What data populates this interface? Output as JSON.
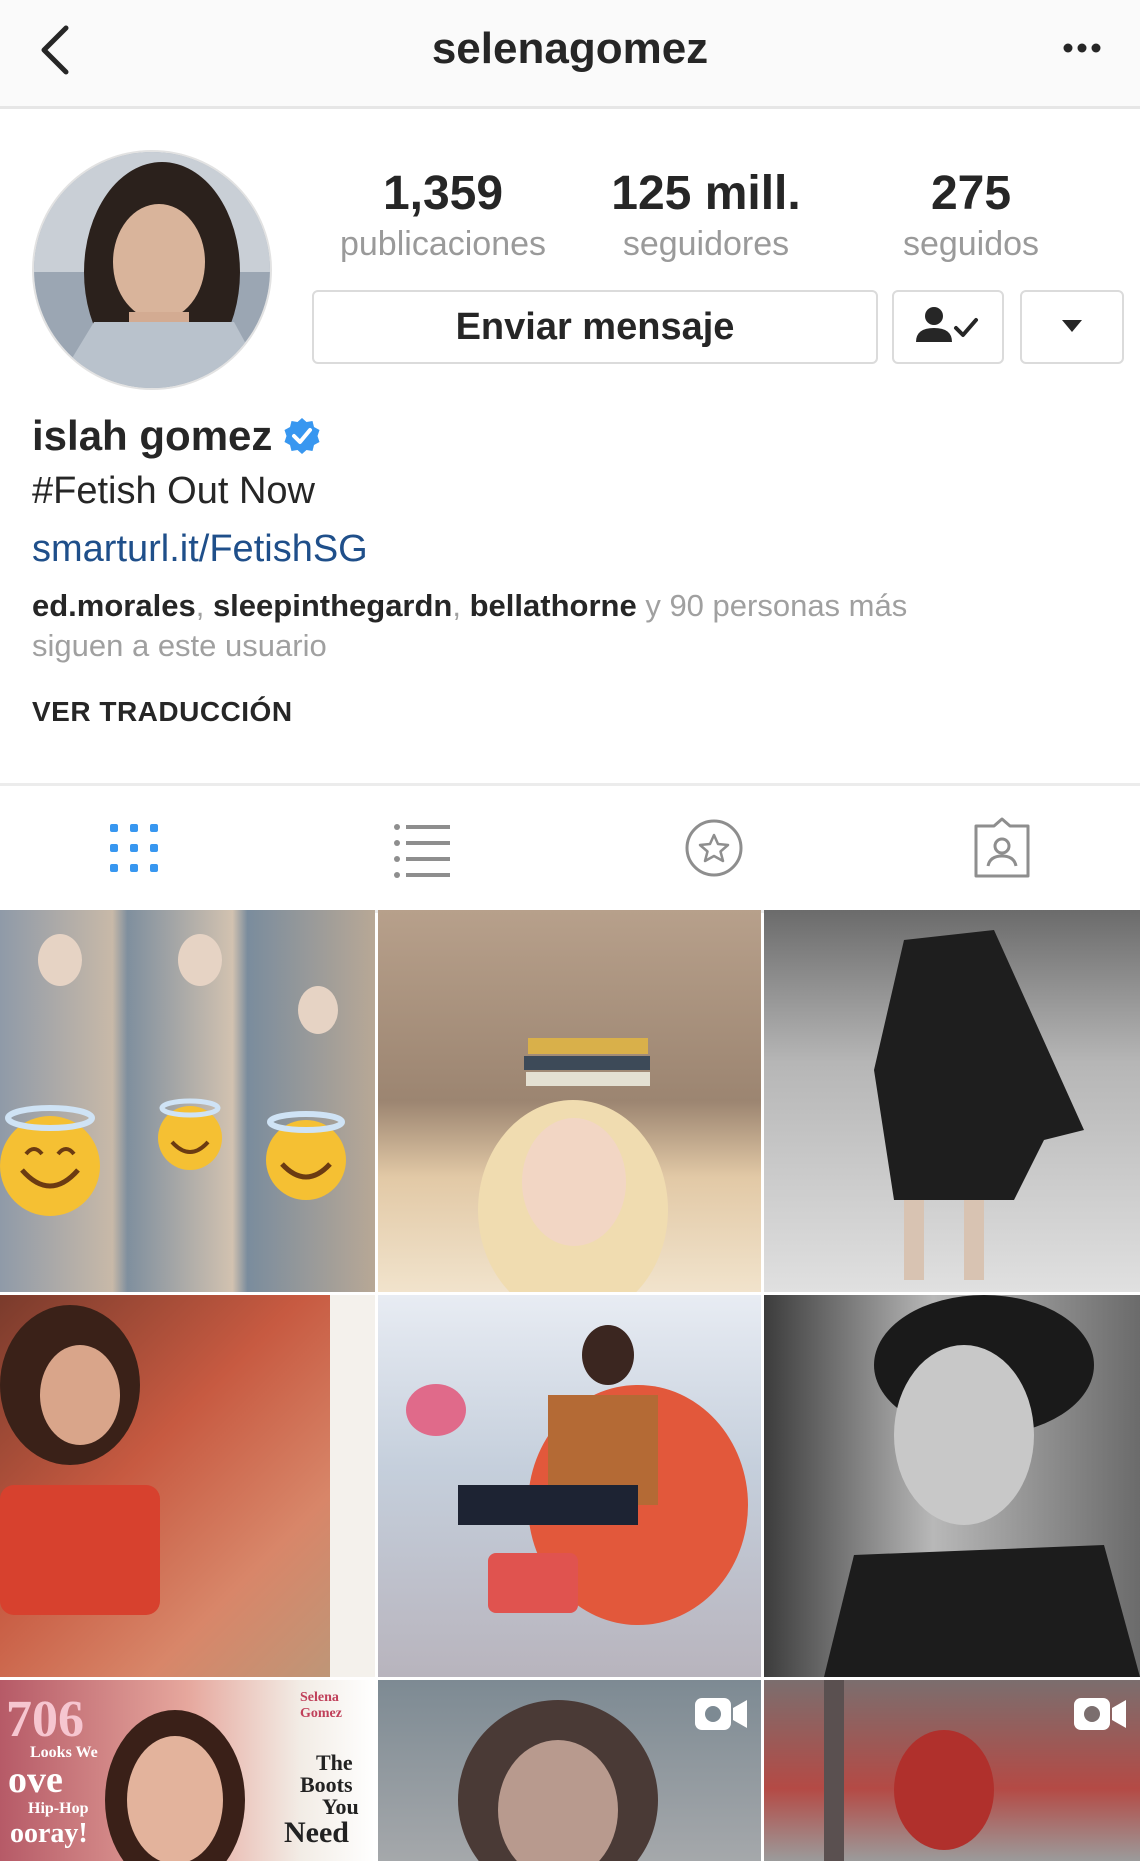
{
  "header": {
    "username": "selenagomez",
    "back_icon": "chevron-left-icon",
    "more_icon": "ellipsis-icon"
  },
  "profile": {
    "stats": [
      {
        "value": "1,359",
        "label": "publicaciones"
      },
      {
        "value": "125 mill.",
        "label": "seguidores"
      },
      {
        "value": "275",
        "label": "seguidos"
      }
    ],
    "message_button": "Enviar mensaje",
    "following_icon": "person-check-icon",
    "dropdown_icon": "caret-down-icon",
    "name": "islah gomez",
    "verified_icon": "verified-badge-icon",
    "bio": "#Fetish Out Now",
    "link": "smarturl.it/FetishSG",
    "followed_by": {
      "users": [
        "ed.morales",
        "sleepinthegardn",
        "bellathorne"
      ],
      "sep": ", ",
      "rest_line1": "y 90 personas más",
      "rest_line2": "siguen a este usuario"
    },
    "translate": "VER TRADUCCIÓN"
  },
  "tabs": [
    {
      "name": "grid-view",
      "icon": "grid-icon",
      "active": true
    },
    {
      "name": "list-view",
      "icon": "list-icon",
      "active": false
    },
    {
      "name": "saved",
      "icon": "star-icon",
      "active": false
    },
    {
      "name": "tagged",
      "icon": "tagged-person-icon",
      "active": false
    }
  ],
  "colors": {
    "accent": "#3897f0",
    "link": "#1f4f8a",
    "muted": "#9a9a9a"
  },
  "grid": {
    "posts": [
      {
        "type": "photo"
      },
      {
        "type": "photo"
      },
      {
        "type": "photo"
      },
      {
        "type": "photo"
      },
      {
        "type": "photo"
      },
      {
        "type": "photo"
      },
      {
        "type": "photo",
        "cover": {
          "big": "706",
          "line1": "Looks We",
          "line2": "ove",
          "line3": "Hip-Hop",
          "line4": "ooray!",
          "right1": "Selena",
          "right2": "Gomez",
          "right3": "The",
          "right4": "Boots",
          "right5": "You",
          "right6": "Need"
        }
      },
      {
        "type": "video",
        "icon": "video-camera-icon"
      },
      {
        "type": "video",
        "icon": "video-camera-icon"
      }
    ]
  }
}
